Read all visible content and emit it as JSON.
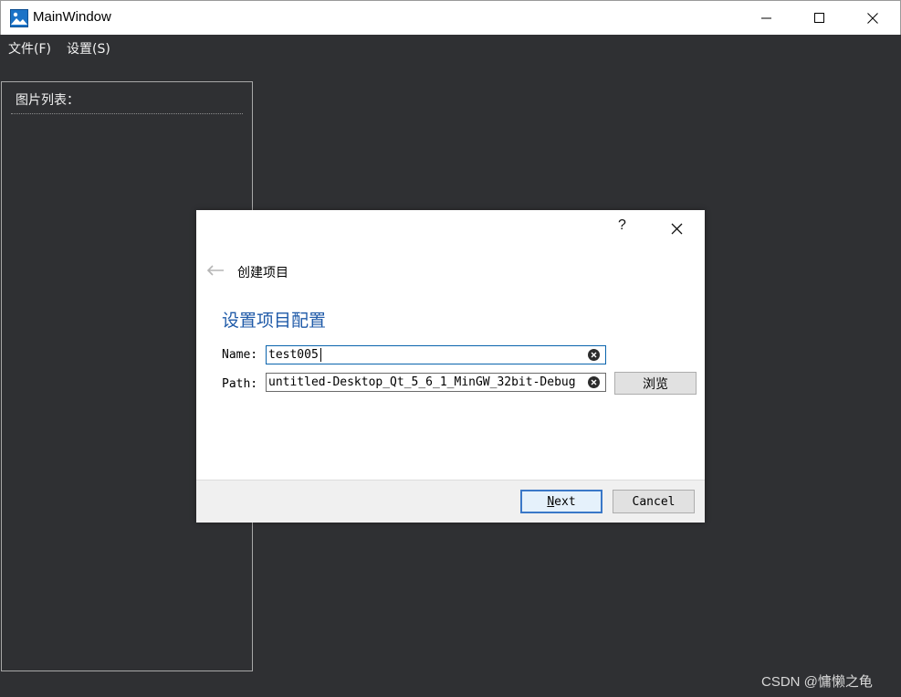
{
  "window": {
    "title": "MainWindow"
  },
  "menu": {
    "file": "文件(F)",
    "settings": "设置(S)"
  },
  "left_panel": {
    "title": "图片列表："
  },
  "dialog": {
    "help": "?",
    "heading": "创建项目",
    "page_title": "设置项目配置",
    "name_label": "Name:",
    "name_value": "test005",
    "path_label": "Path:",
    "path_value": "untitled-Desktop_Qt_5_6_1_MinGW_32bit-Debug",
    "browse_label": "浏览",
    "next_mnemonic": "N",
    "next_rest": "ext",
    "cancel_label": "Cancel"
  },
  "watermark": "CSDN @慵懒之龟",
  "colors": {
    "background": "#2f3033",
    "accent": "#1f5aa8",
    "default_button_border": "#3a78c8"
  }
}
